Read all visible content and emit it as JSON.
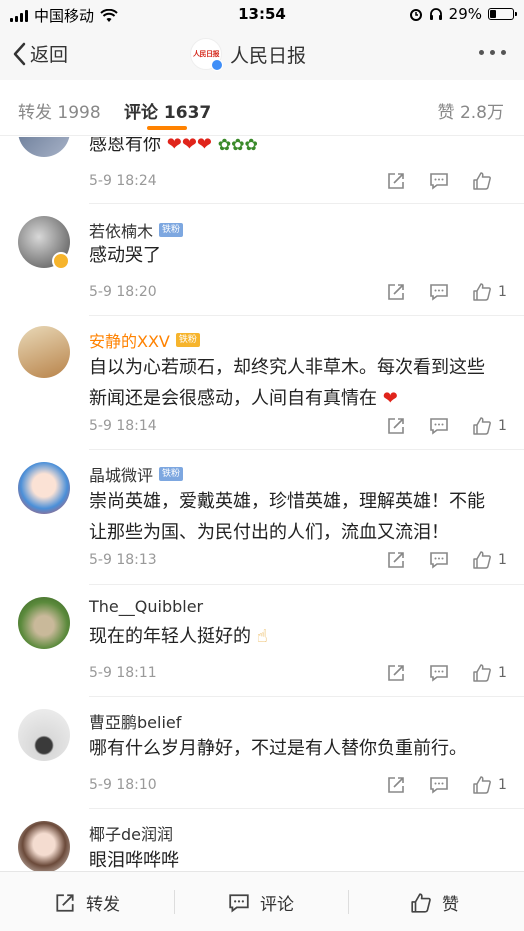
{
  "status_bar": {
    "carrier": "中国移动",
    "time": "13:54",
    "battery": "29%",
    "battery_level": 0.29
  },
  "nav": {
    "back_label": "返回",
    "title": "人民日报",
    "logo_text": "人民日报"
  },
  "tabs": {
    "repost": "转发 1998",
    "comment": "评论 1637",
    "like": "赞 2.8万"
  },
  "comments": [
    {
      "name": "",
      "text": "感恩有你",
      "time": "5-9 18:24",
      "likes": ""
    },
    {
      "name": "若依楠木",
      "badge": "铁粉",
      "text": "感动哭了",
      "time": "5-9 18:20",
      "likes": "1"
    },
    {
      "name": "安静的XXV",
      "badge": "铁粉",
      "text": "自以为心若顽石，却终究人非草木。每次看到这些新闻还是会很感动，人间自有真情在",
      "time": "5-9 18:14",
      "likes": "1"
    },
    {
      "name": "晶城微评",
      "badge": "铁粉",
      "text": "崇尚英雄，爱戴英雄，珍惜英雄，理解英雄！不能让那些为国、为民付出的人们，流血又流泪！",
      "time": "5-9 18:13",
      "likes": "1"
    },
    {
      "name": "The__Quibbler",
      "text": "现在的年轻人挺好的",
      "time": "5-9 18:11",
      "likes": "1"
    },
    {
      "name": "曹亞鹏belief",
      "text": "哪有什么岁月静好，不过是有人替你负重前行。",
      "time": "5-9 18:10",
      "likes": "1"
    },
    {
      "name": "椰子de润润",
      "text": "眼泪哗哗哗",
      "time": "",
      "likes": ""
    }
  ],
  "bottom_bar": {
    "repost": "转发",
    "comment": "评论",
    "like": "赞"
  },
  "colors": {
    "accent": "#ff8200",
    "heart": "#e0241b",
    "badge": "#7da7e0"
  }
}
